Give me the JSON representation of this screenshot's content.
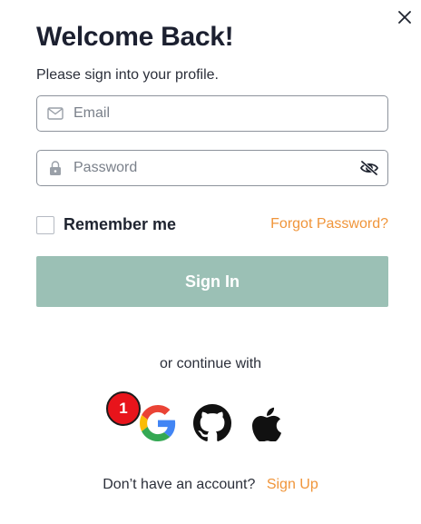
{
  "header": {
    "title": "Welcome Back!",
    "subtitle": "Please sign into your profile.",
    "close_icon": "close-icon"
  },
  "form": {
    "email": {
      "placeholder": "Email",
      "value": "",
      "icon": "mail-icon"
    },
    "password": {
      "placeholder": "Password",
      "value": "",
      "icon": "lock-icon",
      "toggle_icon": "eye-off-icon"
    },
    "remember_label": "Remember me",
    "remember_checked": false,
    "forgot_label": "Forgot Password?",
    "submit_label": "Sign In"
  },
  "social": {
    "divider_text": "or continue with",
    "providers": [
      "google-icon",
      "github-icon",
      "apple-icon"
    ],
    "badge_count": "1"
  },
  "footer": {
    "prompt": "Don’t have an account?",
    "link_label": "Sign Up"
  },
  "colors": {
    "accent": "#f0953a",
    "button_bg": "#9bc0b5",
    "badge_red": "#e8141b",
    "border": "#8d939c"
  }
}
